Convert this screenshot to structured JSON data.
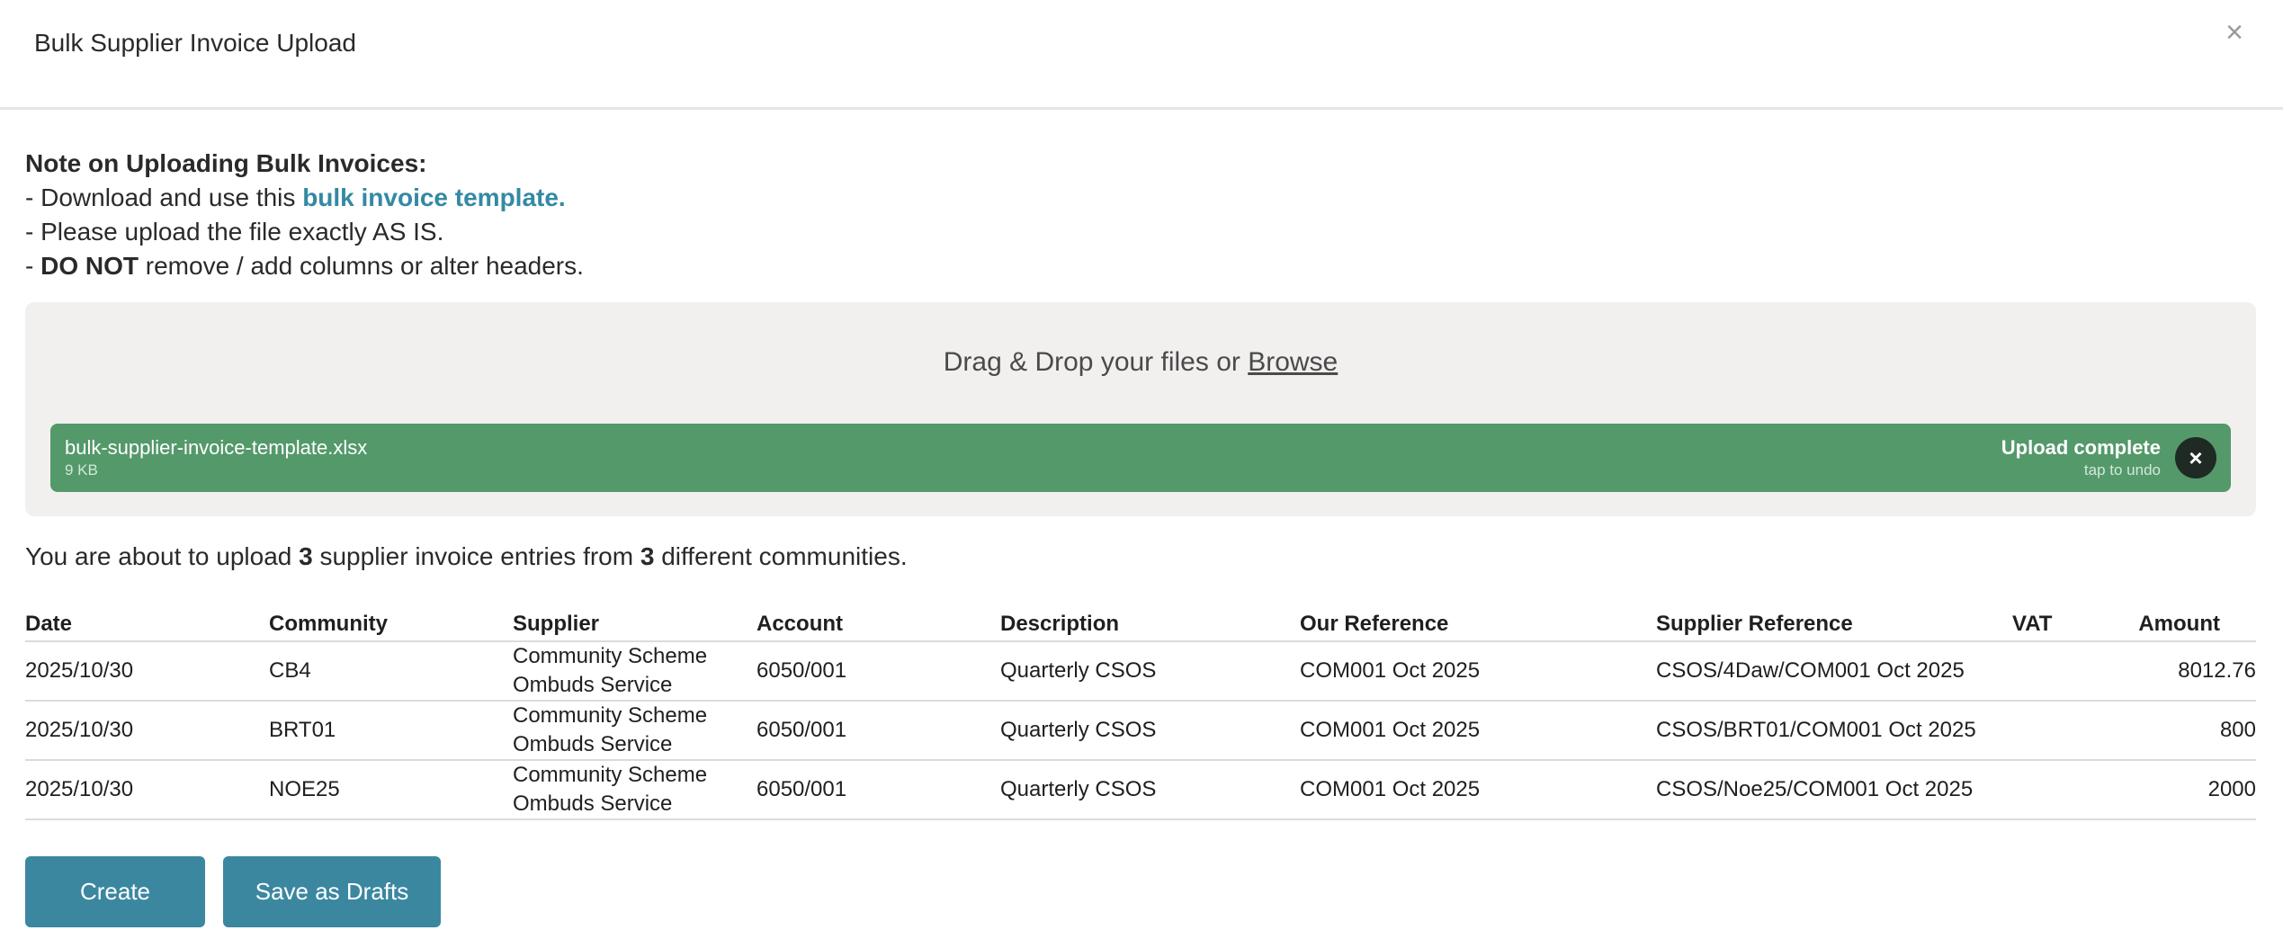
{
  "modal": {
    "title": "Bulk Supplier Invoice Upload",
    "close_symbol": "×",
    "close_icon": "close-icon"
  },
  "notes": {
    "heading": "Note on Uploading Bulk Invoices:",
    "line1_prefix": "- Download and use this ",
    "line1_link": "bulk invoice template.",
    "line2": "- Please upload the file exactly AS IS.",
    "line3_prefix": "- ",
    "line3_bold": "DO NOT",
    "line3_suffix": " remove / add columns or alter headers."
  },
  "dropzone": {
    "prompt_prefix": "Drag & Drop your files or ",
    "browse_label": "Browse",
    "file": {
      "name": "bulk-supplier-invoice-template.xlsx",
      "size": "9 KB",
      "status": "Upload complete",
      "undo_hint": "tap to undo",
      "remove_symbol": "×",
      "status_color": "#54996a"
    }
  },
  "summary": {
    "prefix": "You are about to upload ",
    "entries_count": "3",
    "middle": " supplier invoice entries from ",
    "communities_count": "3",
    "suffix": " different communities."
  },
  "table": {
    "headers": {
      "date": "Date",
      "community": "Community",
      "supplier": "Supplier",
      "account": "Account",
      "description": "Description",
      "our_reference": "Our Reference",
      "supplier_reference": "Supplier Reference",
      "vat": "VAT",
      "amount": "Amount"
    },
    "rows": [
      {
        "date": "2025/10/30",
        "community": "CB4",
        "supplier_line1": "Community Scheme",
        "supplier_line2": "Ombuds Service",
        "account": "6050/001",
        "description": "Quarterly CSOS",
        "our_reference": "COM001 Oct 2025",
        "supplier_reference": "CSOS/4Daw/COM001 Oct 2025",
        "vat": "",
        "amount": "8012.76"
      },
      {
        "date": "2025/10/30",
        "community": "BRT01",
        "supplier_line1": "Community Scheme",
        "supplier_line2": "Ombuds Service",
        "account": "6050/001",
        "description": "Quarterly CSOS",
        "our_reference": "COM001 Oct 2025",
        "supplier_reference": "CSOS/BRT01/COM001 Oct 2025",
        "vat": "",
        "amount": "800"
      },
      {
        "date": "2025/10/30",
        "community": "NOE25",
        "supplier_line1": "Community Scheme",
        "supplier_line2": "Ombuds Service",
        "account": "6050/001",
        "description": "Quarterly CSOS",
        "our_reference": "COM001 Oct 2025",
        "supplier_reference": "CSOS/Noe25/COM001 Oct 2025",
        "vat": "",
        "amount": "2000"
      }
    ]
  },
  "actions": {
    "create_label": "Create",
    "drafts_label": "Save as Drafts",
    "button_color": "#3b87a0"
  }
}
